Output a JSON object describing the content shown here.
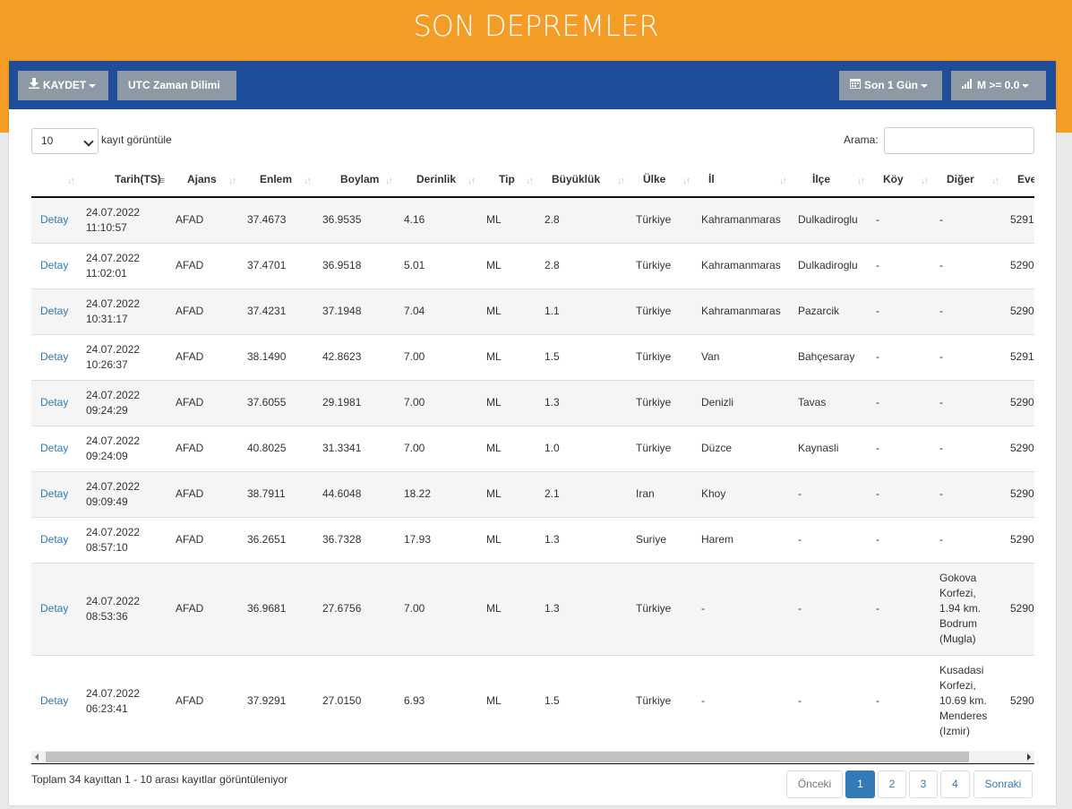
{
  "page": {
    "title": "SON DEPREMLER"
  },
  "toolbar": {
    "save_label": "KAYDET",
    "utc_label": "UTC Zaman Dilimi",
    "range_label": "Son 1 Gün",
    "magnitude_label": "M >= 0.0"
  },
  "controls": {
    "length_value": "10",
    "length_label": "kayıt görüntüle",
    "search_label": "Arama:",
    "search_value": ""
  },
  "table": {
    "columns": [
      "",
      "Tarih(TS)",
      "Ajans",
      "Enlem",
      "Boylam",
      "Derinlik",
      "Tip",
      "Büyüklük",
      "Ülke",
      "İl",
      "İlçe",
      "Köy",
      "Diğer",
      "Eve"
    ],
    "rows": [
      {
        "link": "Detay",
        "date": "24.07.2022",
        "time": "11:10:57",
        "agency": "AFAD",
        "lat": "37.4673",
        "lon": "36.9535",
        "depth": "4.16",
        "type": "ML",
        "mag": "2.8",
        "country": "Türkiye",
        "province": "Kahramanmaras",
        "district": "Dulkadiroglu",
        "village": "-",
        "other": "-",
        "event": "5291"
      },
      {
        "link": "Detay",
        "date": "24.07.2022",
        "time": "11:02:01",
        "agency": "AFAD",
        "lat": "37.4701",
        "lon": "36.9518",
        "depth": "5.01",
        "type": "ML",
        "mag": "2.8",
        "country": "Türkiye",
        "province": "Kahramanmaras",
        "district": "Dulkadiroglu",
        "village": "-",
        "other": "-",
        "event": "5290"
      },
      {
        "link": "Detay",
        "date": "24.07.2022",
        "time": "10:31:17",
        "agency": "AFAD",
        "lat": "37.4231",
        "lon": "37.1948",
        "depth": "7.04",
        "type": "ML",
        "mag": "1.1",
        "country": "Türkiye",
        "province": "Kahramanmaras",
        "district": "Pazarcik",
        "village": "-",
        "other": "-",
        "event": "5290"
      },
      {
        "link": "Detay",
        "date": "24.07.2022",
        "time": "10:26:37",
        "agency": "AFAD",
        "lat": "38.1490",
        "lon": "42.8623",
        "depth": "7.00",
        "type": "ML",
        "mag": "1.5",
        "country": "Türkiye",
        "province": "Van",
        "district": "Bahçesaray",
        "village": "-",
        "other": "-",
        "event": "5291"
      },
      {
        "link": "Detay",
        "date": "24.07.2022",
        "time": "09:24:29",
        "agency": "AFAD",
        "lat": "37.6055",
        "lon": "29.1981",
        "depth": "7.00",
        "type": "ML",
        "mag": "1.3",
        "country": "Türkiye",
        "province": "Denizli",
        "district": "Tavas",
        "village": "-",
        "other": "-",
        "event": "5290"
      },
      {
        "link": "Detay",
        "date": "24.07.2022",
        "time": "09:24:09",
        "agency": "AFAD",
        "lat": "40.8025",
        "lon": "31.3341",
        "depth": "7.00",
        "type": "ML",
        "mag": "1.0",
        "country": "Türkiye",
        "province": "Düzce",
        "district": "Kaynasli",
        "village": "-",
        "other": "-",
        "event": "5290"
      },
      {
        "link": "Detay",
        "date": "24.07.2022",
        "time": "09:09:49",
        "agency": "AFAD",
        "lat": "38.7911",
        "lon": "44.6048",
        "depth": "18.22",
        "type": "ML",
        "mag": "2.1",
        "country": "Iran",
        "province": "Khoy",
        "district": "-",
        "village": "-",
        "other": "-",
        "event": "5290"
      },
      {
        "link": "Detay",
        "date": "24.07.2022",
        "time": "08:57:10",
        "agency": "AFAD",
        "lat": "36.2651",
        "lon": "36.7328",
        "depth": "17.93",
        "type": "ML",
        "mag": "1.3",
        "country": "Suriye",
        "province": "Harem",
        "district": "-",
        "village": "-",
        "other": "-",
        "event": "5290"
      },
      {
        "link": "Detay",
        "date": "24.07.2022",
        "time": "08:53:36",
        "agency": "AFAD",
        "lat": "36.9681",
        "lon": "27.6756",
        "depth": "7.00",
        "type": "ML",
        "mag": "1.3",
        "country": "Türkiye",
        "province": "-",
        "district": "-",
        "village": "-",
        "other": "Gokova Korfezi, 1.94 km. Bodrum (Mugla)",
        "event": "5290"
      },
      {
        "link": "Detay",
        "date": "24.07.2022",
        "time": "06:23:41",
        "agency": "AFAD",
        "lat": "37.9291",
        "lon": "27.0150",
        "depth": "6.93",
        "type": "ML",
        "mag": "1.5",
        "country": "Türkiye",
        "province": "-",
        "district": "-",
        "village": "-",
        "other": "Kusadasi Korfezi, 10.69 km. Menderes (Izmir)",
        "event": "5290"
      }
    ]
  },
  "footer": {
    "info": "Toplam 34 kayıttan 1 - 10 arası kayıtlar görüntüleniyor",
    "prev_label": "Önceki",
    "pages": [
      "1",
      "2",
      "3",
      "4"
    ],
    "active_page": "1",
    "next_label": "Sonraki"
  },
  "colors": {
    "header_band": "#f39c26",
    "toolbar": "#1e4d9a",
    "button": "#8d9aa6",
    "link": "#337ab7"
  }
}
